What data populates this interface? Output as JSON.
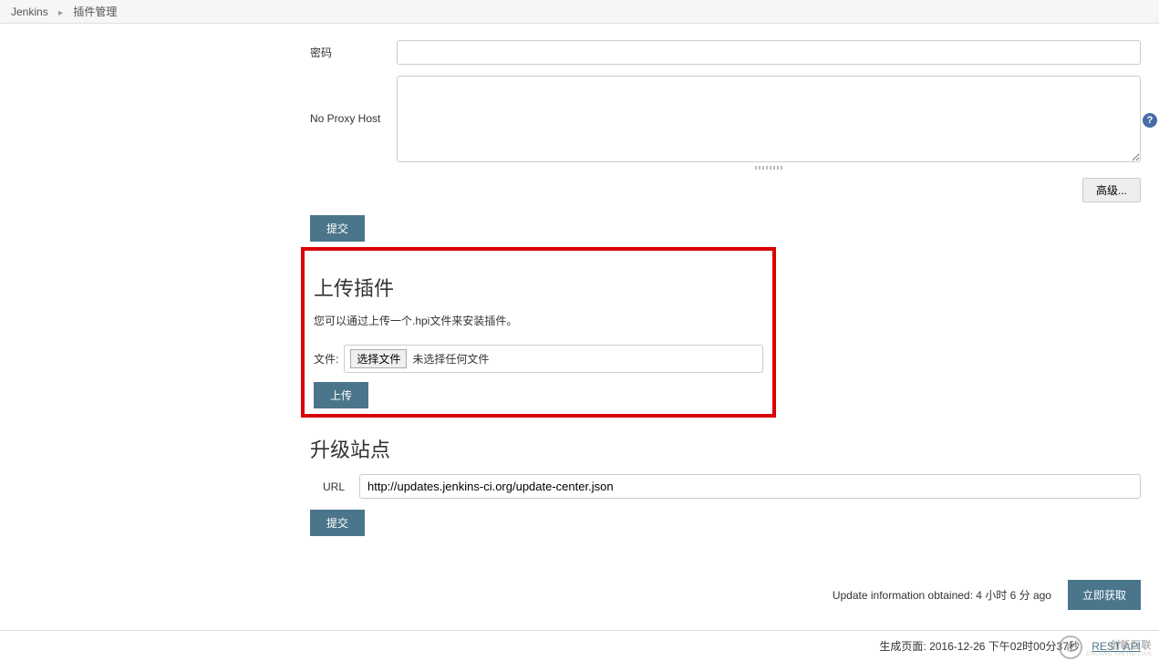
{
  "breadcrumb": {
    "root": "Jenkins",
    "current": "插件管理"
  },
  "proxy": {
    "password_label": "密码",
    "no_proxy_label": "No Proxy Host",
    "advanced_btn": "高级...",
    "submit_btn": "提交"
  },
  "upload": {
    "heading": "上传插件",
    "hint": "您可以通过上传一个.hpi文件来安装插件。",
    "file_label": "文件:",
    "choose_file_btn": "选择文件",
    "no_file_text": "未选择任何文件",
    "upload_btn": "上传"
  },
  "update_site": {
    "heading": "升级站点",
    "url_label": "URL",
    "url_value": "http://updates.jenkins-ci.org/update-center.json",
    "submit_btn": "提交"
  },
  "update_info": {
    "text": "Update information obtained: 4 小时 6 分 ago",
    "get_now_btn": "立即获取"
  },
  "footer": {
    "gen_label": "生成页面:",
    "gen_time": "2016-12-26 下午02时00分37秒",
    "rest_api": "REST API"
  },
  "watermark": {
    "brand": "创新互联",
    "sub": "CHUANG XIN HU LIAN"
  }
}
